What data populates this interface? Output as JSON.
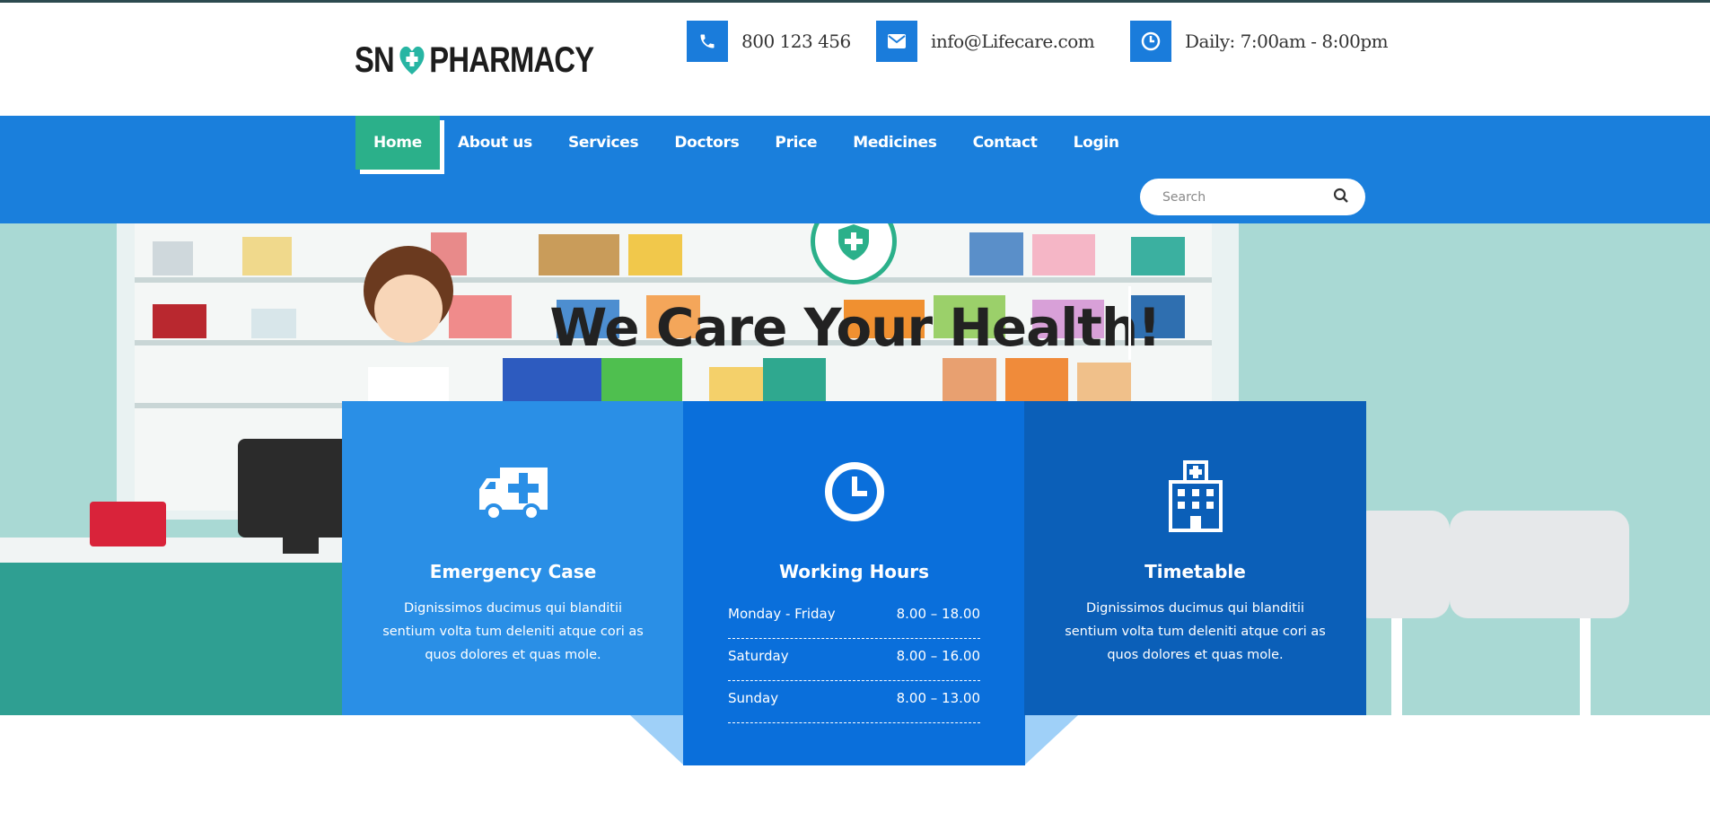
{
  "brand": {
    "logo_text_left": "SN",
    "logo_text_right": "PHARMACY"
  },
  "contacts": [
    {
      "icon": "phone-icon",
      "text": "800 123 456"
    },
    {
      "icon": "envelope-icon",
      "text": "info@Lifecare.com"
    },
    {
      "icon": "clock-icon",
      "text": "Daily: 7:00am - 8:00pm"
    }
  ],
  "nav": {
    "items": [
      "Home",
      "About us",
      "Services",
      "Doctors",
      "Price",
      "Medicines",
      "Contact",
      "Login"
    ],
    "active": "Home"
  },
  "search": {
    "placeholder": "Search",
    "value": ""
  },
  "hero": {
    "title": "We Care Your Health!"
  },
  "features": {
    "emergency": {
      "title": "Emergency Case",
      "text": "Dignissimos ducimus qui blanditii sentium volta tum deleniti atque cori as quos dolores et quas mole."
    },
    "hours": {
      "title": "Working Hours",
      "rows": [
        {
          "day": "Monday - Friday",
          "time": "8.00 – 18.00"
        },
        {
          "day": "Saturday",
          "time": "8.00 – 16.00"
        },
        {
          "day": "Sunday",
          "time": "8.00 – 13.00"
        }
      ]
    },
    "timetable": {
      "title": "Timetable",
      "text": "Dignissimos ducimus qui blanditii sentium volta tum deleniti atque cori as quos dolores et quas mole."
    }
  },
  "colors": {
    "nav_blue": "#1a7fdc",
    "active_green": "#2bb08a",
    "box1": "#2a8fe6",
    "box2": "#0a6fdb",
    "box3": "#0b5fb8"
  }
}
